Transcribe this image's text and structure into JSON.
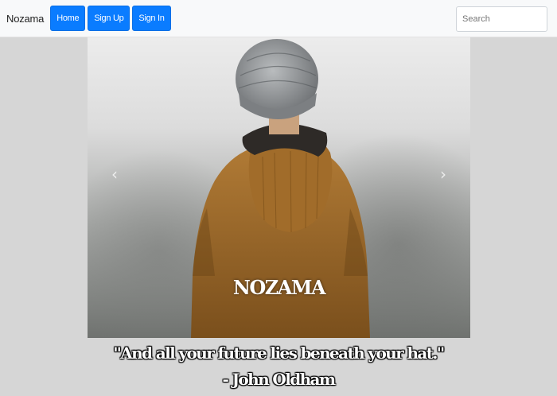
{
  "navbar": {
    "brand": "Nozama",
    "links": [
      {
        "label": "Home"
      },
      {
        "label": "Sign Up"
      },
      {
        "label": "Sign In"
      }
    ],
    "search": {
      "placeholder": "Search",
      "value": ""
    }
  },
  "carousel": {
    "caption": "NOZAMA",
    "prev_icon": "chevron-left-icon",
    "next_icon": "chevron-right-icon"
  },
  "quote": {
    "text": "\"And all your future lies beneath your hat.\"",
    "author": "- John Oldham"
  },
  "colors": {
    "primary_button": "#0a7cff",
    "navbar_bg": "#f8f9fa",
    "page_bg": "#d6d6d6"
  }
}
